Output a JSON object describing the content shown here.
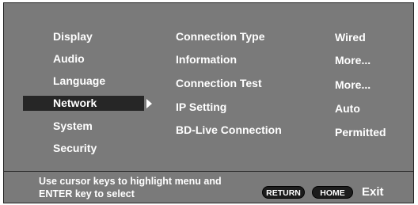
{
  "menu": {
    "items": [
      {
        "label": "Display"
      },
      {
        "label": "Audio"
      },
      {
        "label": "Language"
      },
      {
        "label": "Network"
      },
      {
        "label": "System"
      },
      {
        "label": "Security"
      }
    ],
    "selected": "Network"
  },
  "settings": [
    {
      "label": "Connection Type",
      "value": "Wired"
    },
    {
      "label": "Information",
      "value": "More..."
    },
    {
      "label": "Connection Test",
      "value": "More..."
    },
    {
      "label": "IP Setting",
      "value": "Auto"
    },
    {
      "label": "BD-Live Connection",
      "value": "Permitted"
    }
  ],
  "footer": {
    "help_line1": "Use cursor keys to highlight menu and",
    "help_line2": "ENTER key to select",
    "return_label": "RETURN",
    "home_label": "HOME",
    "exit_label": "Exit"
  },
  "colors": {
    "background": "#7a7a7a",
    "selected_highlight": "#262626",
    "text": "#ffffff"
  }
}
